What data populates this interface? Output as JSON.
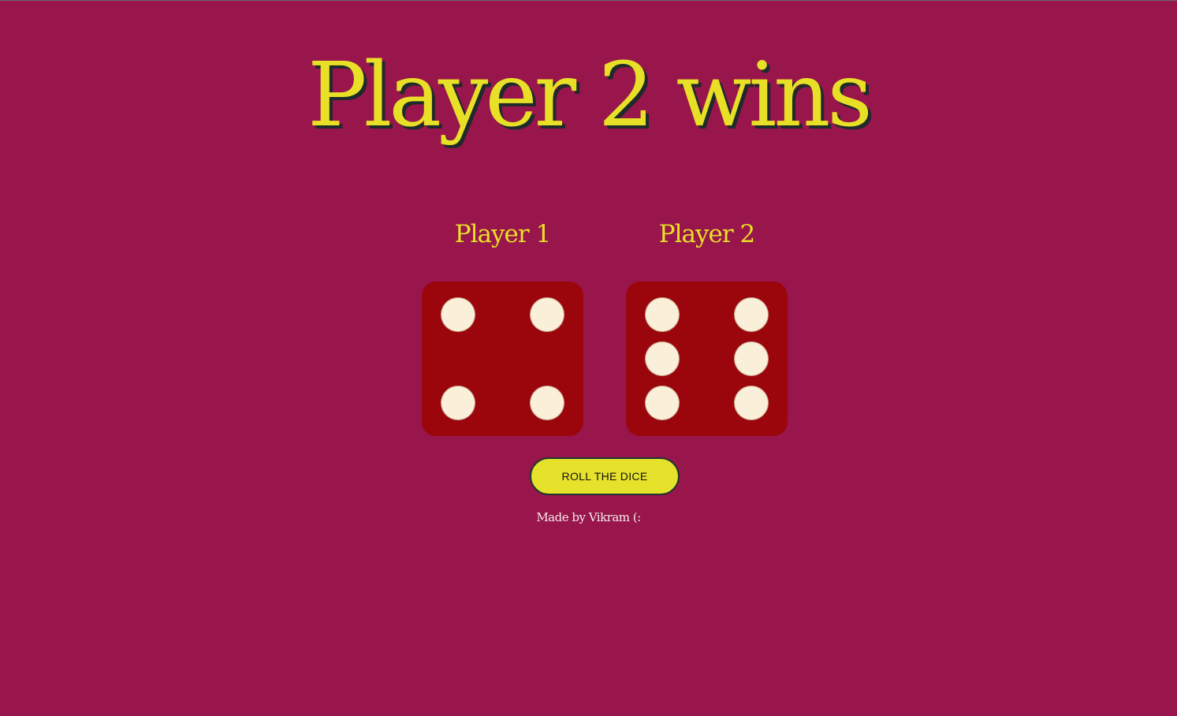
{
  "header": {
    "title": "Player 2 wins"
  },
  "players": [
    {
      "label": "Player 1",
      "die_value": 4
    },
    {
      "label": "Player 2",
      "die_value": 6
    }
  ],
  "controls": {
    "roll_label": "ROLL THE DICE"
  },
  "footer": {
    "credit": "Made by Vikram (:"
  },
  "colors": {
    "background": "#98164c",
    "accent": "#e8e026",
    "die": "#9b050c",
    "pip": "#faf0d9"
  }
}
